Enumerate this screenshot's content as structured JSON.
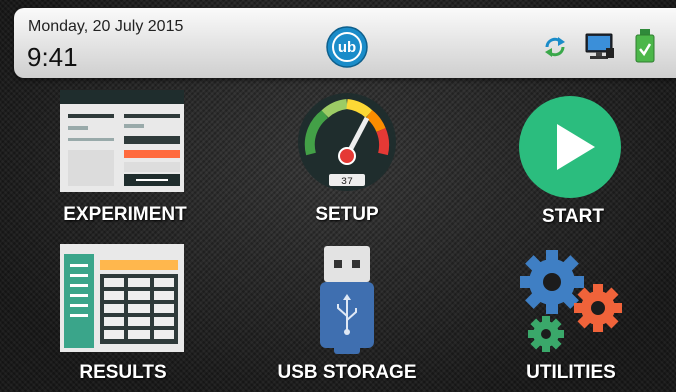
{
  "status_bar": {
    "date": "Monday, 20 July 2015",
    "time": "9:41",
    "icons": [
      "sync-icon",
      "network-monitor-icon",
      "usb-battery-ok-icon"
    ],
    "accent": "#1a8cc9"
  },
  "tiles": [
    {
      "label": "EXPERIMENT",
      "icon": "experiment-form-icon"
    },
    {
      "label": "SETUP",
      "icon": "gauge-icon",
      "gauge_readout": "37"
    },
    {
      "label": "START",
      "icon": "play-icon"
    },
    {
      "label": "RESULTS",
      "icon": "results-table-icon"
    },
    {
      "label": "USB STORAGE",
      "icon": "usb-drive-icon"
    },
    {
      "label": "UTILITIES",
      "icon": "gears-icon"
    }
  ]
}
